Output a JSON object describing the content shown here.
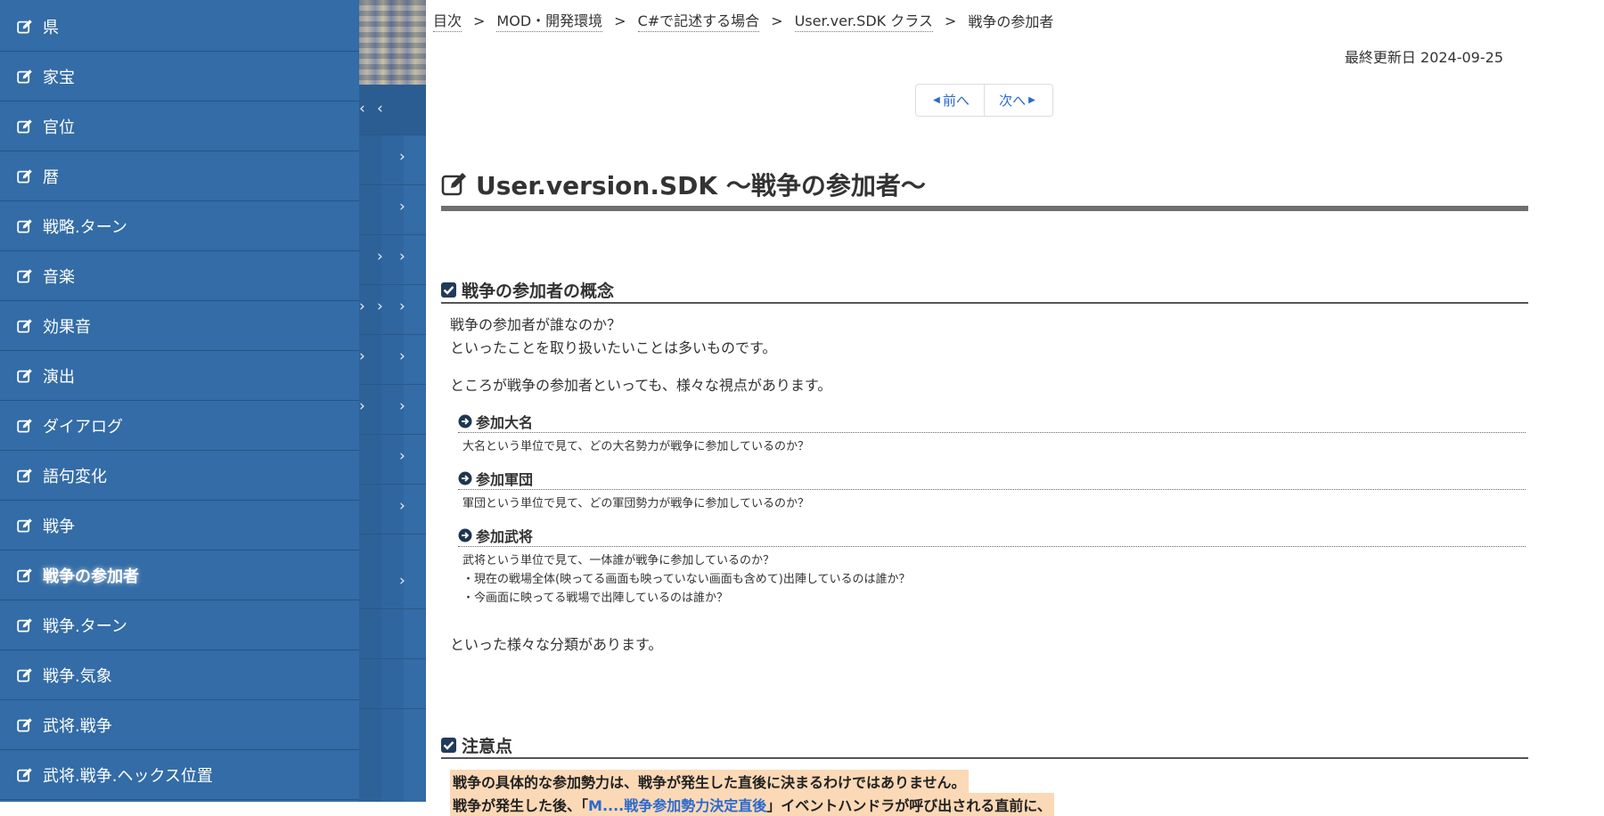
{
  "sidebar": {
    "items": [
      {
        "label": "県"
      },
      {
        "label": "家宝"
      },
      {
        "label": "官位"
      },
      {
        "label": "暦"
      },
      {
        "label": "戦略.ターン"
      },
      {
        "label": "音楽"
      },
      {
        "label": "効果音"
      },
      {
        "label": "演出"
      },
      {
        "label": "ダイアログ"
      },
      {
        "label": "語句変化"
      },
      {
        "label": "戦争"
      },
      {
        "label": "戦争の参加者",
        "active": true
      },
      {
        "label": "戦争.ターン"
      },
      {
        "label": "戦争.気象"
      },
      {
        "label": "武将.戦争"
      },
      {
        "label": "武将.戦争.ヘックス位置"
      }
    ]
  },
  "breadcrumb": {
    "items": [
      "目次",
      "MOD・開発環境",
      "C#で記述する場合",
      "User.ver.SDK クラス"
    ],
    "current": "戦争の参加者",
    "separator": ">"
  },
  "updated": "最終更新日 2024-09-25",
  "pager": {
    "prev": "前へ",
    "next": "次へ"
  },
  "page_title": "User.version.SDK 〜戦争の参加者〜",
  "sections": [
    {
      "title": "戦争の参加者の概念",
      "intro_lines": [
        "戦争の参加者が誰なのか？",
        "といったことを取り扱いたいことは多いものです。"
      ],
      "intro2": "ところが戦争の参加者といっても、様々な視点があります。",
      "subs": [
        {
          "title": "参加大名",
          "lines": [
            "大名という単位で見て、どの大名勢力が戦争に参加しているのか？"
          ]
        },
        {
          "title": "参加軍団",
          "lines": [
            "軍団という単位で見て、どの軍団勢力が戦争に参加しているのか？"
          ]
        },
        {
          "title": "参加武将",
          "lines": [
            "武将という単位で見て、一体誰が戦争に参加しているのか？",
            "・現在の戦場全体(映ってる画面も映っていない画面も含めて)出陣しているのは誰か？",
            "・今画面に映ってる戦場で出陣しているのは誰か？"
          ]
        }
      ],
      "outro": "といった様々な分類があります。"
    },
    {
      "title": "注意点",
      "highlight1": "戦争の具体的な参加勢力は、戦争が発生した直後に決まるわけではありません。",
      "highlight2_pre": "戦争が発生した後、「",
      "highlight2_link": "M....戦争参加勢力決定直後",
      "highlight2_post": "」イベントハンドラが呼び出される直前に、"
    }
  ],
  "colors": {
    "sidebar_bg": "#336ca6",
    "link": "#2a6ad0",
    "highlight_bg": "#fcd9b6"
  }
}
